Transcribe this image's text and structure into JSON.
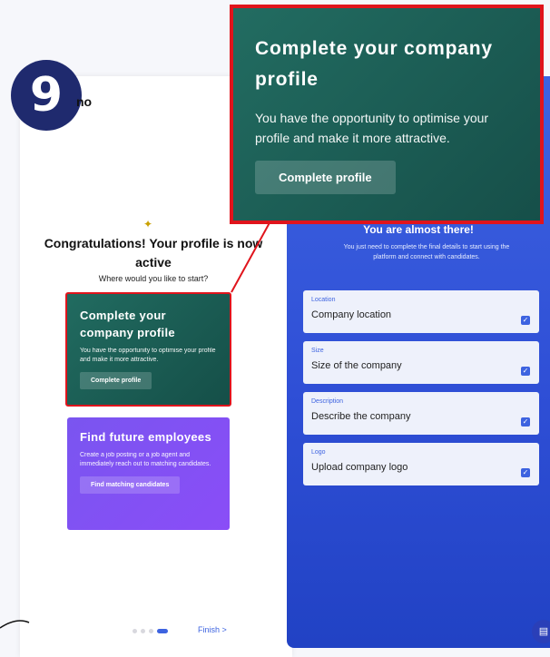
{
  "step_badge": "9",
  "logo_text": "no",
  "emoji_icon": "party-popper",
  "left": {
    "congrats_title": "Congratulations! Your profile is now active",
    "question": "Where would you like to start?",
    "cards": [
      {
        "title": "Complete your company profile",
        "desc": "You have the opportunity to optimise your profile and make it more attractive.",
        "button": "Complete profile"
      },
      {
        "title": "Find future employees",
        "desc": "Create a job posting or a job agent and immediately reach out to matching candidates.",
        "button": "Find matching candidates"
      }
    ],
    "finish_label": "Finish >"
  },
  "zoom": {
    "title": "Complete your company profile",
    "desc": "You have the opportunity to optimise your profile and make it more attractive.",
    "button": "Complete profile"
  },
  "right": {
    "heading": "You are almost there!",
    "desc": "You just need to complete the final details to start using the platform and connect with candidates.",
    "fields": [
      {
        "label": "Location",
        "value": "Company location"
      },
      {
        "label": "Size",
        "value": "Size of the company"
      },
      {
        "label": "Description",
        "value": "Describe the company"
      },
      {
        "label": "Logo",
        "value": "Upload company logo"
      }
    ]
  },
  "colors": {
    "accent": "#3d63e0",
    "highlight": "#e0141c",
    "green": "#216b60",
    "purple": "#7a55f0"
  }
}
